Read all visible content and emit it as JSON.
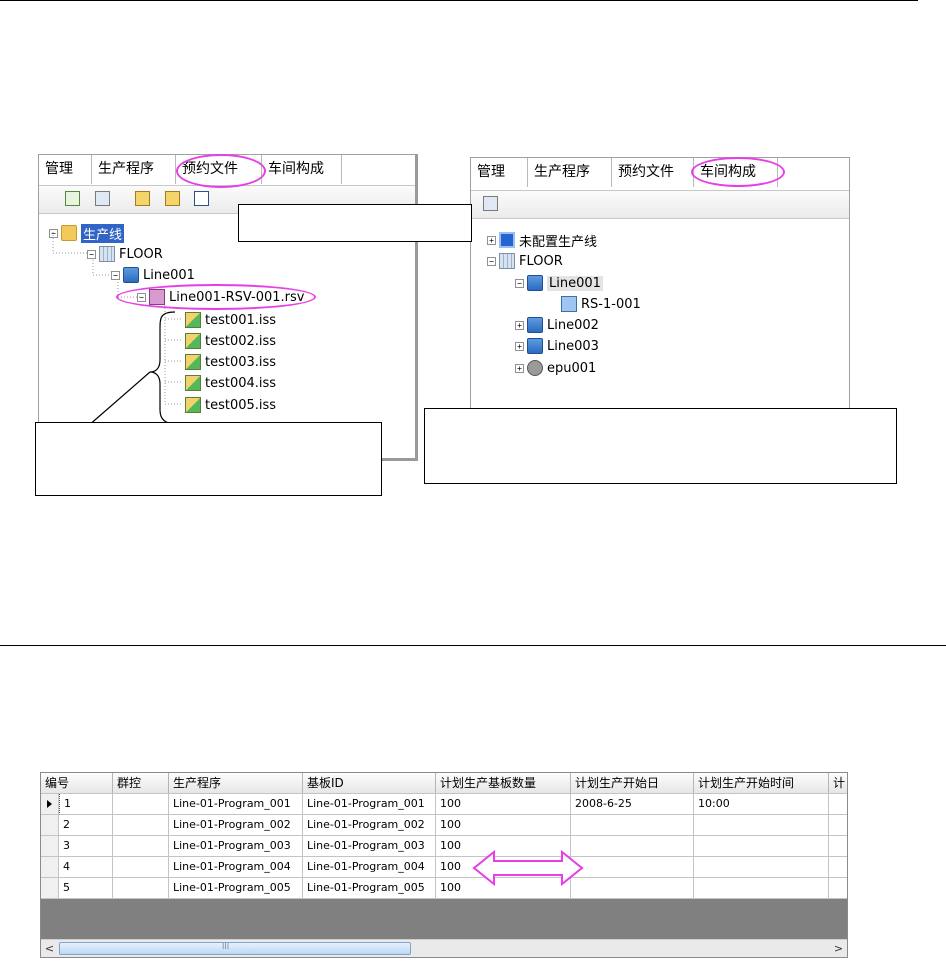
{
  "left_panel": {
    "tabs": [
      "管理",
      "生产程序",
      "预约文件",
      "车间构成"
    ],
    "toolbar_icons": [
      "refresh-icon",
      "properties-icon",
      "copy-icon",
      "paste-icon",
      "export-icon"
    ],
    "tree": {
      "root": "生产线",
      "floor": "FLOOR",
      "line": "Line001",
      "rsv": "Line001-RSV-001.rsv",
      "files": [
        "test001.iss",
        "test002.iss",
        "test003.iss",
        "test004.iss",
        "test005.iss"
      ]
    }
  },
  "right_panel": {
    "tabs": [
      "管理",
      "生产程序",
      "预约文件",
      "车间构成"
    ],
    "toolbar_icons": [
      "properties-icon"
    ],
    "tree": {
      "unassigned": "未配置生产线",
      "floor": "FLOOR",
      "line1": "Line001",
      "rs": "RS-1-001",
      "line2": "Line002",
      "line3": "Line003",
      "epu": "epu001"
    }
  },
  "grid": {
    "columns": [
      "编号",
      "群控",
      "生产程序",
      "基板ID",
      "计划生产基板数量",
      "计划生产开始日",
      "计划生产开始时间",
      "计"
    ],
    "rows": [
      [
        "1",
        "",
        "Line-01-Program_001",
        "Line-01-Program_001",
        "100",
        "2008-6-25",
        "10:00"
      ],
      [
        "2",
        "",
        "Line-01-Program_002",
        "Line-01-Program_002",
        "100",
        "",
        ""
      ],
      [
        "3",
        "",
        "Line-01-Program_003",
        "Line-01-Program_003",
        "100",
        "",
        ""
      ],
      [
        "4",
        "",
        "Line-01-Program_004",
        "Line-01-Program_004",
        "100",
        "",
        ""
      ],
      [
        "5",
        "",
        "Line-01-Program_005",
        "Line-01-Program_005",
        "100",
        "",
        ""
      ]
    ],
    "scroll_thumb_grip": "III"
  },
  "colors": {
    "highlight": "#e83ee8",
    "selection": "#3064c6"
  }
}
